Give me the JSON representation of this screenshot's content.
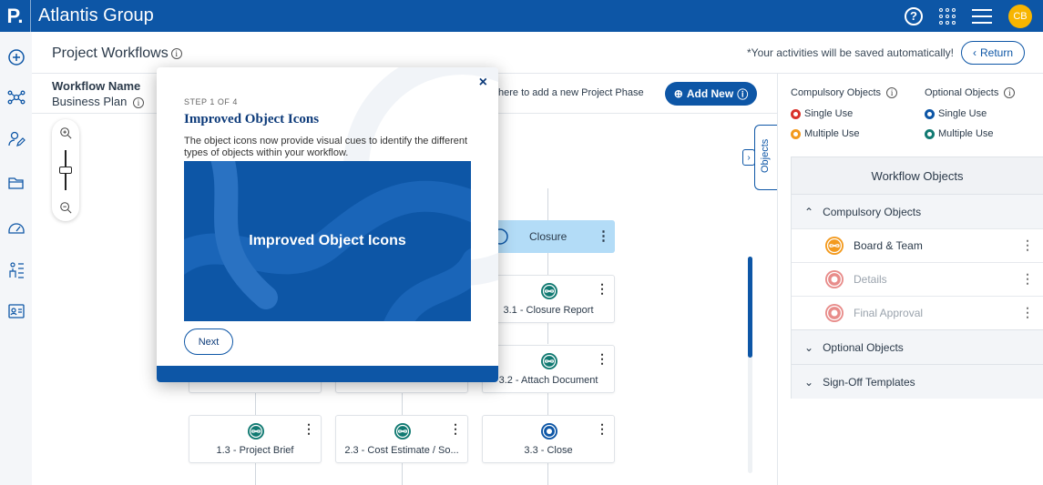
{
  "app": {
    "logo": "P.",
    "company": "Atlantis Group",
    "avatar_initials": "CB",
    "help_glyph": "?"
  },
  "header": {
    "title": "Project Workflows",
    "autosave_note": "*Your activities will be saved automatically!",
    "return_label": "Return"
  },
  "workflow": {
    "name_label": "Workflow Name",
    "name_value": "Business Plan",
    "add_phase_hint": "here to add a new Project Phase",
    "add_new_label": "Add New"
  },
  "rail_icons": [
    "add-icon",
    "network-icon",
    "edit-user-icon",
    "folder-icon",
    "dashboard-icon",
    "org-chart-icon",
    "id-card-icon"
  ],
  "canvas": {
    "phase_card": {
      "label": "Closure"
    },
    "cards": [
      {
        "label": "3.1 - Closure Report",
        "kind": "multiple-compulsory"
      },
      {
        "label": "3.2 - Attach Document",
        "kind": "multiple-compulsory"
      },
      {
        "label": "1.3 - Project Brief",
        "kind": "multiple-compulsory"
      },
      {
        "label": "2.3 - Cost Estimate / So...",
        "kind": "multiple-compulsory"
      },
      {
        "label": "3.3 - Close",
        "kind": "single-optional"
      }
    ],
    "objects_tab_label": "Objects"
  },
  "legend": {
    "compulsory_heading": "Compulsory Objects",
    "optional_heading": "Optional Objects",
    "single_use": "Single Use",
    "multiple_use": "Multiple Use"
  },
  "workflow_objects": {
    "title": "Workflow Objects",
    "compulsory_section": "Compulsory Objects",
    "items": [
      {
        "label": "Board & Team",
        "enabled": true
      },
      {
        "label": "Details",
        "enabled": false
      },
      {
        "label": "Final Approval",
        "enabled": false
      }
    ],
    "optional_section": "Optional Objects",
    "signoff_section": "Sign-Off Templates"
  },
  "tour": {
    "step": "STEP 1 OF 4",
    "title": "Improved Object Icons",
    "description": "The object icons now provide visual cues to identify the different types of objects within your workflow.",
    "illustration_text": "Improved Object Icons",
    "next_label": "Next",
    "close_glyph": "×"
  },
  "colors": {
    "brand": "#0d56a6",
    "single_compulsory": "#d9322b",
    "multiple_compulsory": "#f39a1e",
    "single_optional": "#0d56a6",
    "multiple_optional": "#117a72"
  }
}
